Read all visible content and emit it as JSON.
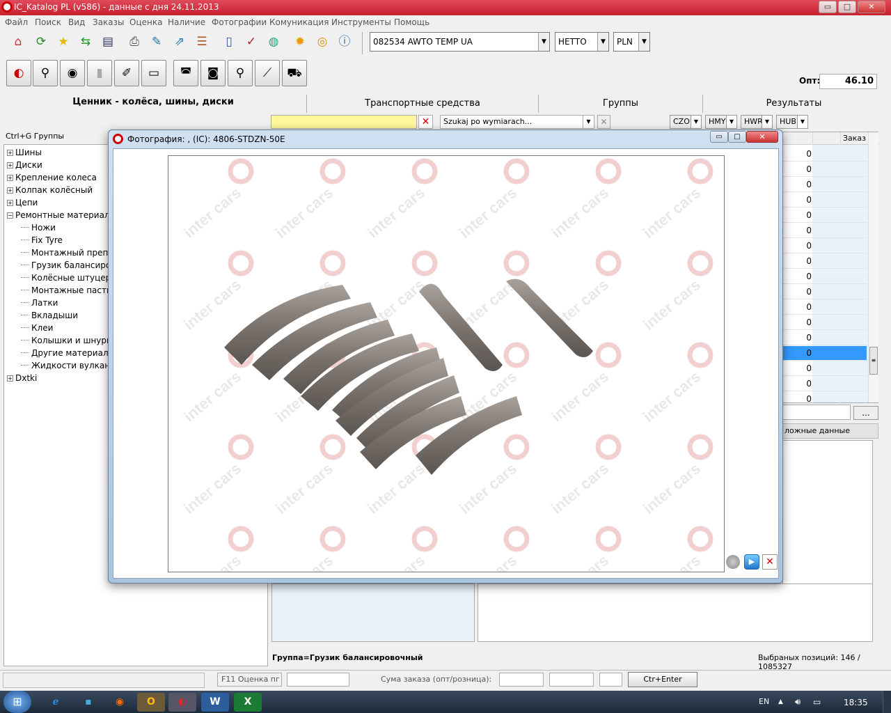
{
  "app": {
    "title": "IC_Katalog PL (v586) - данные с дня 24.11.2013",
    "btn_min": "▭",
    "btn_max": "□",
    "btn_close": "✕"
  },
  "menu": [
    "Файл",
    "Поиск",
    "Вид",
    "Заказы",
    "Оценка",
    "Наличие",
    "Фотографии",
    "Комуникация",
    "Инструменты",
    "Помощь"
  ],
  "toolbar": {
    "icons": [
      "home-icon",
      "refresh-icon",
      "star-icon",
      "arrows-icon",
      "document-icon",
      "printer-icon",
      "pen-icon",
      "export-icon",
      "list-icon",
      "user-doc-icon",
      "check-doc-icon",
      "globe-icon",
      "gear-icon",
      "coins-icon",
      "info-icon"
    ],
    "customer": "082534  AWTO TEMP UA",
    "price_type": "НЕТТО",
    "currency": "PLN",
    "opt_label": "Опт:",
    "opt_value": "46.10"
  },
  "headers": {
    "price_list": "Ценник - колёса, шины, диски",
    "vehicles": "Транспортные средства",
    "groups": "Группы",
    "results": "Результаты"
  },
  "search": {
    "dims_placeholder": "Szukaj po wymiarach...",
    "filters": [
      "CZO",
      "HMY",
      "HWR",
      "HUB"
    ]
  },
  "tree": {
    "hint": "Ctrl+G Группы",
    "items": [
      {
        "label": "Шины",
        "level": 0,
        "expand": "+"
      },
      {
        "label": "Диски",
        "level": 0,
        "expand": "+"
      },
      {
        "label": "Крепление колеса",
        "level": 0,
        "expand": "+"
      },
      {
        "label": "Колпак колёсный",
        "level": 0,
        "expand": "+"
      },
      {
        "label": "Цепи",
        "level": 0,
        "expand": "+"
      },
      {
        "label": "Ремонтные материалы",
        "level": 0,
        "expand": "−"
      },
      {
        "label": "Ножи",
        "level": 1
      },
      {
        "label": "Fix Tyre",
        "level": 1
      },
      {
        "label": "Монтажный препарат",
        "level": 1
      },
      {
        "label": "Грузик балансировочный",
        "level": 1
      },
      {
        "label": "Колёсные штуцера",
        "level": 1
      },
      {
        "label": "Монтажные пасты",
        "level": 1
      },
      {
        "label": "Латки",
        "level": 1
      },
      {
        "label": "Вкладыши",
        "level": 1
      },
      {
        "label": "Клеи",
        "level": 1
      },
      {
        "label": "Колышки и шнуры",
        "level": 1
      },
      {
        "label": "Другие материалы",
        "level": 1
      },
      {
        "label": "Жидкости вулканизационные",
        "level": 1
      },
      {
        "label": "Dxtki",
        "level": 0,
        "expand": "+"
      }
    ]
  },
  "results": {
    "order_col": "Заказ",
    "values": [
      "0",
      "0",
      "0",
      "0",
      "0",
      "0",
      "0",
      "0",
      "0",
      "0",
      "0",
      "0",
      "0",
      "0",
      "0",
      "0",
      "0"
    ],
    "selected_index": 13,
    "more_btn": "...",
    "details_tab": "ложные данные"
  },
  "photo": {
    "title": "Фотография: , (IC): 4806-STDZN-50E",
    "watermark": "inter cars",
    "btn_min": "▭",
    "btn_max": "□",
    "btn_close": "✕"
  },
  "status": {
    "group": "Группа=Грузик балансировочный",
    "selected": "Выбраных позиций: 146 / 1085327",
    "f11": "F11 Оценка пг",
    "order_sum": "Сума заказа (опт/розница):",
    "order_btn": "Ctr+Enter заказы"
  },
  "taskbar": {
    "lang": "EN",
    "time": "18:35",
    "apps": [
      "ie-icon",
      "save-icon",
      "firefox-icon",
      "outlook-icon",
      "ic-katalog-icon",
      "word-icon",
      "excel-icon"
    ]
  },
  "colors": {
    "titlebar": "#d42a3a",
    "selection": "#3399ff",
    "search_yellow": "#fff799",
    "taskbar": "#1d2a3a"
  }
}
